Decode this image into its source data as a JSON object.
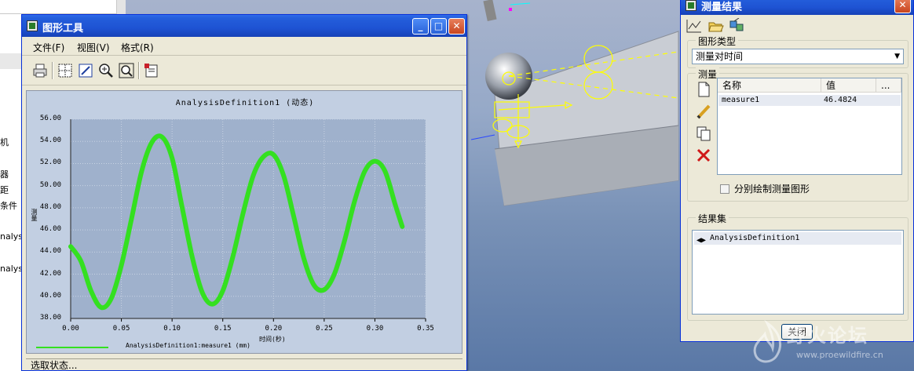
{
  "background_app": {
    "tree_fragments": [
      "机",
      "器",
      "距",
      "条件",
      "nalys",
      "nalys"
    ]
  },
  "graph_window": {
    "title": "图形工具",
    "menus": [
      "文件(F)",
      "视图(V)",
      "格式(R)"
    ],
    "toolbar_icons": [
      "print-icon",
      "grid-icon",
      "fit-icon",
      "zoom-in-icon",
      "zoom-window-icon",
      "export-icon"
    ],
    "status": "选取状态..."
  },
  "chart_data": {
    "type": "line",
    "title": "AnalysisDefinition1 (动态)",
    "xlabel": "时间(秒)",
    "ylabel": "测量",
    "xlim": [
      0.0,
      0.35
    ],
    "ylim": [
      38.0,
      56.0
    ],
    "x_ticks": [
      "0.00",
      "0.05",
      "0.10",
      "0.15",
      "0.20",
      "0.25",
      "0.30",
      "0.35"
    ],
    "y_ticks": [
      "38.00",
      "40.00",
      "42.00",
      "44.00",
      "46.00",
      "48.00",
      "50.00",
      "52.00",
      "54.00",
      "56.00"
    ],
    "grid": true,
    "line_color": "#34e020",
    "series": [
      {
        "name": "AnalysisDefinition1:measure1 (mm)",
        "x": [
          0.0,
          0.01,
          0.02,
          0.03,
          0.04,
          0.05,
          0.06,
          0.07,
          0.08,
          0.09,
          0.1,
          0.11,
          0.12,
          0.13,
          0.14,
          0.15,
          0.16,
          0.17,
          0.18,
          0.19,
          0.2,
          0.21,
          0.22,
          0.23,
          0.24,
          0.25,
          0.26,
          0.27,
          0.28,
          0.29,
          0.3,
          0.31,
          0.32,
          0.327
        ],
        "y": [
          44.5,
          43.2,
          40.5,
          39.0,
          39.8,
          42.8,
          47.0,
          51.3,
          53.9,
          54.4,
          52.5,
          48.0,
          43.5,
          40.3,
          39.3,
          40.5,
          43.6,
          47.5,
          50.9,
          52.6,
          52.8,
          50.9,
          47.2,
          43.4,
          41.0,
          40.6,
          42.0,
          45.0,
          48.6,
          51.3,
          52.2,
          51.3,
          48.3,
          46.3
        ]
      }
    ]
  },
  "measure_window": {
    "title": "测量结果",
    "toolbar_icons": [
      "graph-icon",
      "open-folder-icon",
      "info-icon"
    ],
    "type_group_label": "图形类型",
    "type_selected": "测量对时间",
    "measure_group_label": "测量",
    "table_headers": [
      "名称",
      "值",
      "..."
    ],
    "rows": [
      {
        "name": "measure1",
        "value": "46.4824"
      }
    ],
    "side_icons": [
      "new-icon",
      "edit-icon",
      "copy-icon",
      "delete-icon"
    ],
    "separate_plot_label": "分别绘制测量图形",
    "result_group_label": "结果集",
    "result_items": [
      "AnalysisDefinition1"
    ],
    "close_label": "关闭"
  },
  "watermark": {
    "title": "野火论坛",
    "url": "www.proewildfire.cn"
  }
}
